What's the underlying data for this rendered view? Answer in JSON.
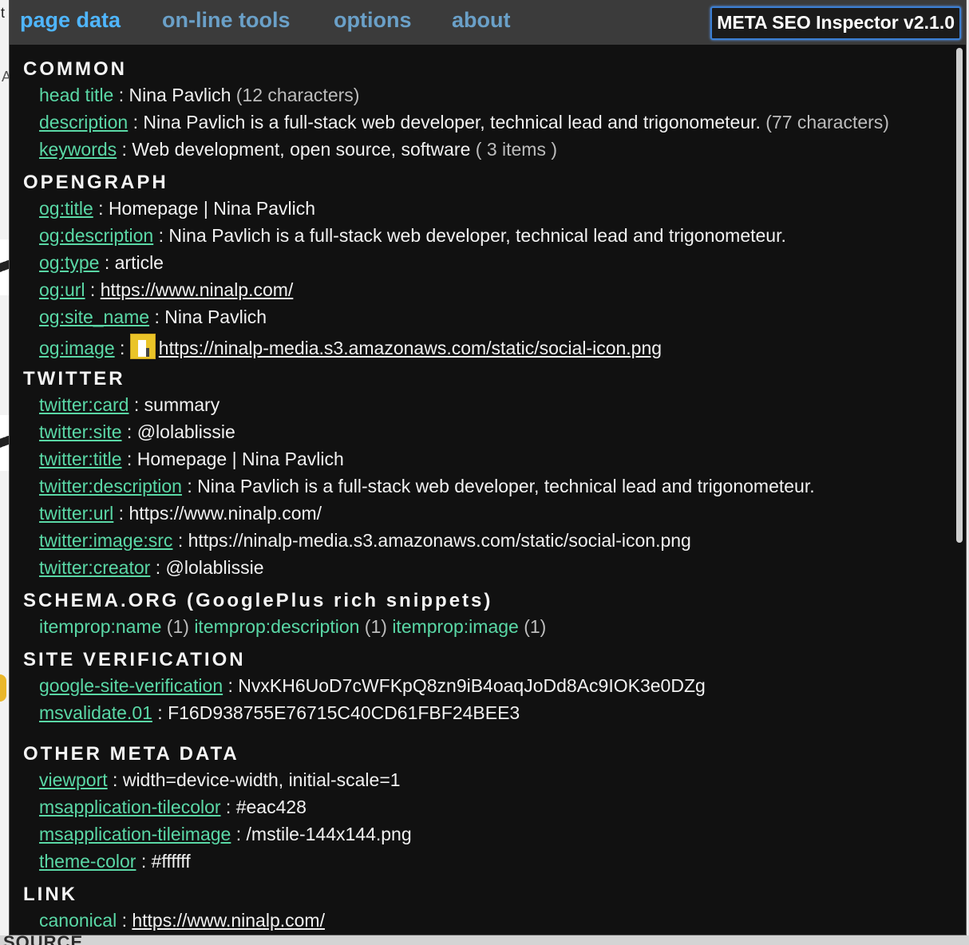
{
  "menu": {
    "tabs": [
      "page data",
      "on-line tools",
      "options",
      "about"
    ],
    "version": "META SEO Inspector v2.1.0"
  },
  "sections": {
    "common": "COMMON",
    "opengraph": "OPENGRAPH",
    "twitter": "TWITTER",
    "schema": "SCHEMA.ORG (GooglePlus rich snippets)",
    "verification": "SITE VERIFICATION",
    "other": "OTHER META DATA",
    "link": "LINK"
  },
  "common": [
    {
      "key": "head title",
      "sep": " : ",
      "value": "Nina Pavlich",
      "extra": " (12 characters)"
    },
    {
      "key": "description",
      "sep": " : ",
      "value": "Nina Pavlich is a full-stack web developer, technical lead and trigonometeur.",
      "extra": " (77 characters)"
    },
    {
      "key": "keywords",
      "sep": " : ",
      "value": "Web development, open source, software",
      "extra": " ( 3 items )"
    }
  ],
  "opengraph": [
    {
      "key": "og:title",
      "sep": " : ",
      "value": "Homepage | Nina Pavlich"
    },
    {
      "key": "og:description",
      "sep": " : ",
      "value": "Nina Pavlich is a full-stack web developer, technical lead and trigonometeur."
    },
    {
      "key": "og:type",
      "sep": " : ",
      "value": "article"
    },
    {
      "key": "og:url",
      "sep": " : ",
      "value": "https://www.ninalp.com/"
    },
    {
      "key": "og:site_name",
      "sep": " : ",
      "value": "Nina Pavlich"
    },
    {
      "key": "og:image",
      "sep": " : ",
      "value": "https://ninalp-media.s3.amazonaws.com/static/social-icon.png"
    }
  ],
  "twitter": [
    {
      "key": "twitter:card",
      "sep": " : ",
      "value": "summary"
    },
    {
      "key": "twitter:site",
      "sep": " : ",
      "value": "@lolablissie"
    },
    {
      "key": "twitter:title",
      "sep": " : ",
      "value": "Homepage | Nina Pavlich"
    },
    {
      "key": "twitter:description",
      "sep": " : ",
      "value": "Nina Pavlich is a full-stack web developer, technical lead and trigonometeur."
    },
    {
      "key": "twitter:url",
      "sep": " : ",
      "value": "https://www.ninalp.com/"
    },
    {
      "key": "twitter:image:src",
      "sep": " : ",
      "value": "https://ninalp-media.s3.amazonaws.com/static/social-icon.png"
    },
    {
      "key": "twitter:creator",
      "sep": " : ",
      "value": "@lolablissie"
    }
  ],
  "schema": [
    {
      "key": "itemprop:name",
      "count": " (1) "
    },
    {
      "key": "itemprop:description",
      "count": " (1) "
    },
    {
      "key": "itemprop:image",
      "count": " (1)"
    }
  ],
  "verification": [
    {
      "key": "google-site-verification",
      "sep": " : ",
      "value": "NvxKH6UoD7cWFKpQ8zn9iB4oaqJoDd8Ac9IOK3e0DZg"
    },
    {
      "key": "msvalidate.01",
      "sep": " : ",
      "value": "F16D938755E76715C40CD61FBF24BEE3"
    }
  ],
  "other": [
    {
      "key": "viewport",
      "sep": " : ",
      "value": "width=device-width, initial-scale=1"
    },
    {
      "key": "msapplication-tilecolor",
      "sep": " : ",
      "value": "#eac428"
    },
    {
      "key": "msapplication-tileimage",
      "sep": " : ",
      "value": "/mstile-144x144.png"
    },
    {
      "key": "theme-color",
      "sep": " : ",
      "value": "#ffffff"
    }
  ],
  "link": [
    {
      "key": "canonical",
      "sep": " : ",
      "value": "https://www.ninalp.com/"
    }
  ],
  "background": {
    "left_char": "t",
    "left_char2": "A",
    "bottom_text": "SOURCE"
  },
  "colors": {
    "key_green": "#5ad8a6",
    "tab_blue": "#6aa0c8",
    "popup_bg": "#111111",
    "menu_bg": "#3b3b3b"
  }
}
